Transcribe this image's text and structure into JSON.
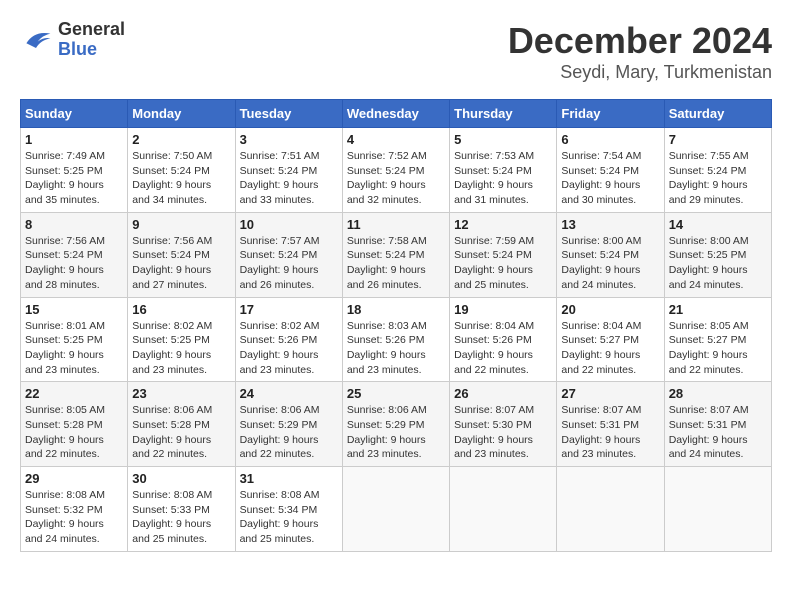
{
  "header": {
    "logo_line1": "General",
    "logo_line2": "Blue",
    "title": "December 2024",
    "subtitle": "Seydi, Mary, Turkmenistan"
  },
  "calendar": {
    "weekdays": [
      "Sunday",
      "Monday",
      "Tuesday",
      "Wednesday",
      "Thursday",
      "Friday",
      "Saturday"
    ],
    "weeks": [
      [
        {
          "day": "1",
          "sunrise": "7:49 AM",
          "sunset": "5:25 PM",
          "daylight": "9 hours and 35 minutes."
        },
        {
          "day": "2",
          "sunrise": "7:50 AM",
          "sunset": "5:24 PM",
          "daylight": "9 hours and 34 minutes."
        },
        {
          "day": "3",
          "sunrise": "7:51 AM",
          "sunset": "5:24 PM",
          "daylight": "9 hours and 33 minutes."
        },
        {
          "day": "4",
          "sunrise": "7:52 AM",
          "sunset": "5:24 PM",
          "daylight": "9 hours and 32 minutes."
        },
        {
          "day": "5",
          "sunrise": "7:53 AM",
          "sunset": "5:24 PM",
          "daylight": "9 hours and 31 minutes."
        },
        {
          "day": "6",
          "sunrise": "7:54 AM",
          "sunset": "5:24 PM",
          "daylight": "9 hours and 30 minutes."
        },
        {
          "day": "7",
          "sunrise": "7:55 AM",
          "sunset": "5:24 PM",
          "daylight": "9 hours and 29 minutes."
        }
      ],
      [
        {
          "day": "8",
          "sunrise": "7:56 AM",
          "sunset": "5:24 PM",
          "daylight": "9 hours and 28 minutes."
        },
        {
          "day": "9",
          "sunrise": "7:56 AM",
          "sunset": "5:24 PM",
          "daylight": "9 hours and 27 minutes."
        },
        {
          "day": "10",
          "sunrise": "7:57 AM",
          "sunset": "5:24 PM",
          "daylight": "9 hours and 26 minutes."
        },
        {
          "day": "11",
          "sunrise": "7:58 AM",
          "sunset": "5:24 PM",
          "daylight": "9 hours and 26 minutes."
        },
        {
          "day": "12",
          "sunrise": "7:59 AM",
          "sunset": "5:24 PM",
          "daylight": "9 hours and 25 minutes."
        },
        {
          "day": "13",
          "sunrise": "8:00 AM",
          "sunset": "5:24 PM",
          "daylight": "9 hours and 24 minutes."
        },
        {
          "day": "14",
          "sunrise": "8:00 AM",
          "sunset": "5:25 PM",
          "daylight": "9 hours and 24 minutes."
        }
      ],
      [
        {
          "day": "15",
          "sunrise": "8:01 AM",
          "sunset": "5:25 PM",
          "daylight": "9 hours and 23 minutes."
        },
        {
          "day": "16",
          "sunrise": "8:02 AM",
          "sunset": "5:25 PM",
          "daylight": "9 hours and 23 minutes."
        },
        {
          "day": "17",
          "sunrise": "8:02 AM",
          "sunset": "5:26 PM",
          "daylight": "9 hours and 23 minutes."
        },
        {
          "day": "18",
          "sunrise": "8:03 AM",
          "sunset": "5:26 PM",
          "daylight": "9 hours and 23 minutes."
        },
        {
          "day": "19",
          "sunrise": "8:04 AM",
          "sunset": "5:26 PM",
          "daylight": "9 hours and 22 minutes."
        },
        {
          "day": "20",
          "sunrise": "8:04 AM",
          "sunset": "5:27 PM",
          "daylight": "9 hours and 22 minutes."
        },
        {
          "day": "21",
          "sunrise": "8:05 AM",
          "sunset": "5:27 PM",
          "daylight": "9 hours and 22 minutes."
        }
      ],
      [
        {
          "day": "22",
          "sunrise": "8:05 AM",
          "sunset": "5:28 PM",
          "daylight": "9 hours and 22 minutes."
        },
        {
          "day": "23",
          "sunrise": "8:06 AM",
          "sunset": "5:28 PM",
          "daylight": "9 hours and 22 minutes."
        },
        {
          "day": "24",
          "sunrise": "8:06 AM",
          "sunset": "5:29 PM",
          "daylight": "9 hours and 22 minutes."
        },
        {
          "day": "25",
          "sunrise": "8:06 AM",
          "sunset": "5:29 PM",
          "daylight": "9 hours and 23 minutes."
        },
        {
          "day": "26",
          "sunrise": "8:07 AM",
          "sunset": "5:30 PM",
          "daylight": "9 hours and 23 minutes."
        },
        {
          "day": "27",
          "sunrise": "8:07 AM",
          "sunset": "5:31 PM",
          "daylight": "9 hours and 23 minutes."
        },
        {
          "day": "28",
          "sunrise": "8:07 AM",
          "sunset": "5:31 PM",
          "daylight": "9 hours and 24 minutes."
        }
      ],
      [
        {
          "day": "29",
          "sunrise": "8:08 AM",
          "sunset": "5:32 PM",
          "daylight": "9 hours and 24 minutes."
        },
        {
          "day": "30",
          "sunrise": "8:08 AM",
          "sunset": "5:33 PM",
          "daylight": "9 hours and 25 minutes."
        },
        {
          "day": "31",
          "sunrise": "8:08 AM",
          "sunset": "5:34 PM",
          "daylight": "9 hours and 25 minutes."
        },
        null,
        null,
        null,
        null
      ]
    ]
  }
}
